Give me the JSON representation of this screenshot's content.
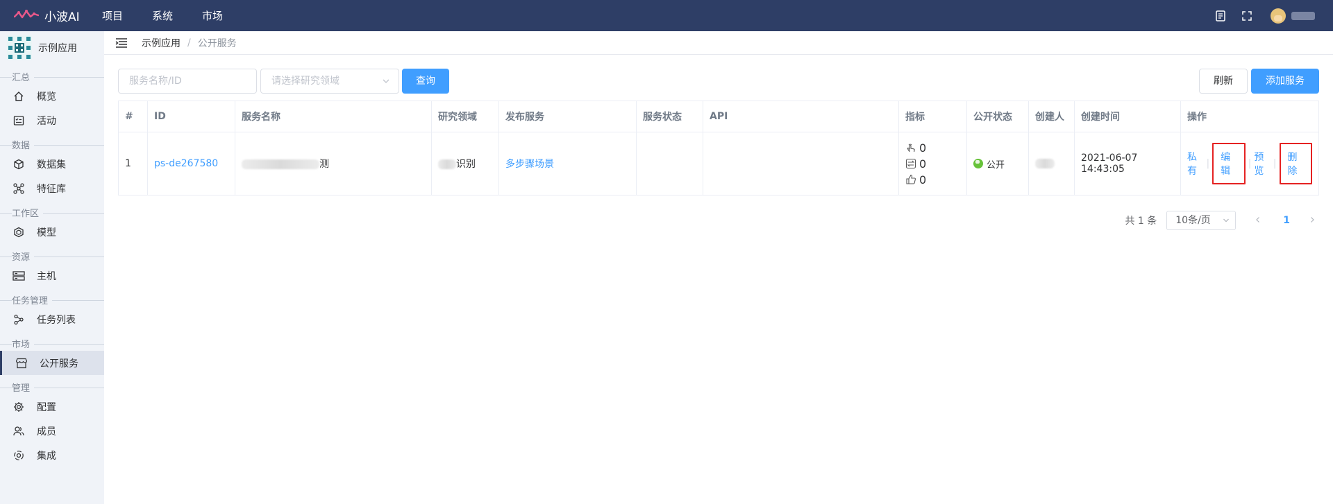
{
  "topbar": {
    "brand": "小波AI",
    "nav": [
      "项目",
      "系统",
      "市场"
    ]
  },
  "sidebar": {
    "app_name": "示例应用",
    "groups": [
      {
        "title": "汇总",
        "items": [
          {
            "label": "概览",
            "icon": "home-icon"
          },
          {
            "label": "活动",
            "icon": "activity-list-icon"
          }
        ]
      },
      {
        "title": "数据",
        "items": [
          {
            "label": "数据集",
            "icon": "cube-icon"
          },
          {
            "label": "特征库",
            "icon": "feature-graph-icon"
          }
        ]
      },
      {
        "title": "工作区",
        "items": [
          {
            "label": "模型",
            "icon": "model-cube-icon"
          }
        ]
      },
      {
        "title": "资源",
        "items": [
          {
            "label": "主机",
            "icon": "server-icon"
          }
        ]
      },
      {
        "title": "任务管理",
        "items": [
          {
            "label": "任务列表",
            "icon": "task-share-icon"
          }
        ]
      },
      {
        "title": "市场",
        "items": [
          {
            "label": "公开服务",
            "icon": "store-icon",
            "active": true
          }
        ]
      },
      {
        "title": "管理",
        "items": [
          {
            "label": "配置",
            "icon": "gear-icon"
          },
          {
            "label": "成员",
            "icon": "members-icon"
          },
          {
            "label": "集成",
            "icon": "integration-icon"
          }
        ]
      }
    ]
  },
  "breadcrumb": {
    "current": "示例应用",
    "separator": "/",
    "page": "公开服务"
  },
  "toolbar": {
    "search_placeholder": "服务名称/ID",
    "domain_placeholder": "请选择研究领域",
    "query_label": "查询",
    "refresh_label": "刷新",
    "add_label": "添加服务"
  },
  "table": {
    "headers": [
      "#",
      "ID",
      "服务名称",
      "研究领域",
      "发布服务",
      "服务状态",
      "API",
      "指标",
      "公开状态",
      "创建人",
      "创建时间",
      "操作"
    ],
    "rows": [
      {
        "index": "1",
        "id": "ps-de267580",
        "name_suffix": "测",
        "domain_suffix": "识别",
        "publish": "多步骤场景",
        "status": "",
        "api": "",
        "metrics": [
          "0",
          "0",
          "0"
        ],
        "public_status": "公开",
        "created": "2021-06-07 14:43:05",
        "actions": [
          "私有",
          "编辑",
          "预览",
          "删除"
        ]
      }
    ]
  },
  "pagination": {
    "total": "共 1 条",
    "page_size": "10条/页",
    "current": "1"
  },
  "colors": {
    "topbar": "#2e3e66",
    "primary": "#409eff",
    "highlight_box": "#e52222"
  }
}
